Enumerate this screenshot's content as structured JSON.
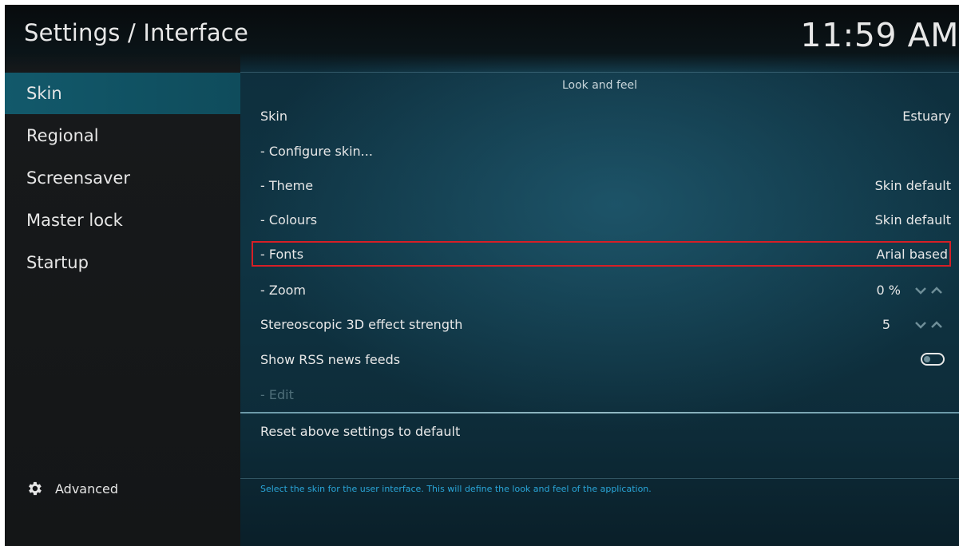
{
  "header": {
    "title": "Settings / Interface",
    "clock": "11:59 AM"
  },
  "sidebar": {
    "items": [
      {
        "label": "Skin",
        "active": true
      },
      {
        "label": "Regional",
        "active": false
      },
      {
        "label": "Screensaver",
        "active": false
      },
      {
        "label": "Master lock",
        "active": false
      },
      {
        "label": "Startup",
        "active": false
      }
    ],
    "advanced": {
      "label": "Advanced",
      "icon": "gear-icon"
    }
  },
  "section": {
    "title": "Look and feel"
  },
  "settings": [
    {
      "label": "Skin",
      "value": "Estuary"
    },
    {
      "label": "- Configure skin...",
      "value": ""
    },
    {
      "label": "- Theme",
      "value": "Skin default"
    },
    {
      "label": "- Colours",
      "value": "Skin default"
    },
    {
      "label": "- Fonts",
      "value": "Arial based",
      "focused": true
    },
    {
      "label": "- Zoom",
      "value": "0 %",
      "control": "spinner"
    },
    {
      "label": "Stereoscopic 3D effect strength",
      "value": "5",
      "control": "spinner"
    },
    {
      "label": "Show RSS news feeds",
      "value": "",
      "control": "toggle",
      "toggle_on": false
    },
    {
      "label": "- Edit",
      "value": "",
      "disabled": true
    }
  ],
  "reset": {
    "label": "Reset above settings to default"
  },
  "footer": {
    "description": "Select the skin for the user interface. This will define the look and feel of the application."
  },
  "colors": {
    "accent_active": "#12596b",
    "focus_border": "#d61f26",
    "description_text": "#2aa6d9"
  }
}
